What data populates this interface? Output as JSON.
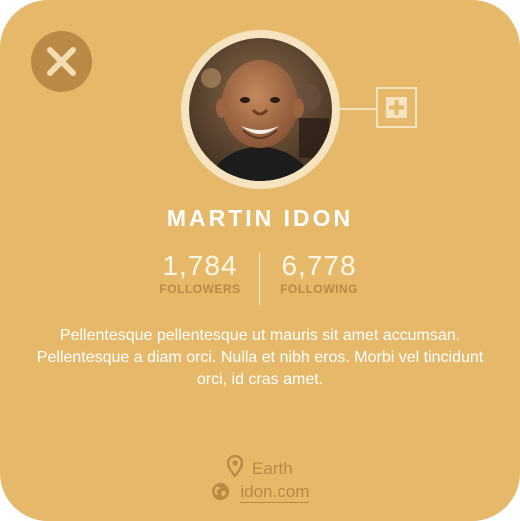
{
  "profile": {
    "name": "MARTIN IDON",
    "stats": [
      {
        "value": "1,784",
        "label": "FOLLOWERS"
      },
      {
        "value": "6,778",
        "label": "FOLLOWING"
      }
    ],
    "bio": "Pellentesque pellentesque ut mauris sit amet accumsan. Pellentesque a diam orci. Nulla et nibh eros. Morbi vel tincidunt orci, id cras amet.",
    "location": "Earth",
    "website": "idon.com"
  },
  "icons": {
    "close": "close-icon",
    "add": "plus-icon",
    "location": "map-pin-icon",
    "website": "globe-icon"
  },
  "colors": {
    "card_background": "#e6b96a",
    "accent_dark": "#b98a45",
    "ring": "#f6e4c0",
    "text_light": "#ffffff"
  }
}
